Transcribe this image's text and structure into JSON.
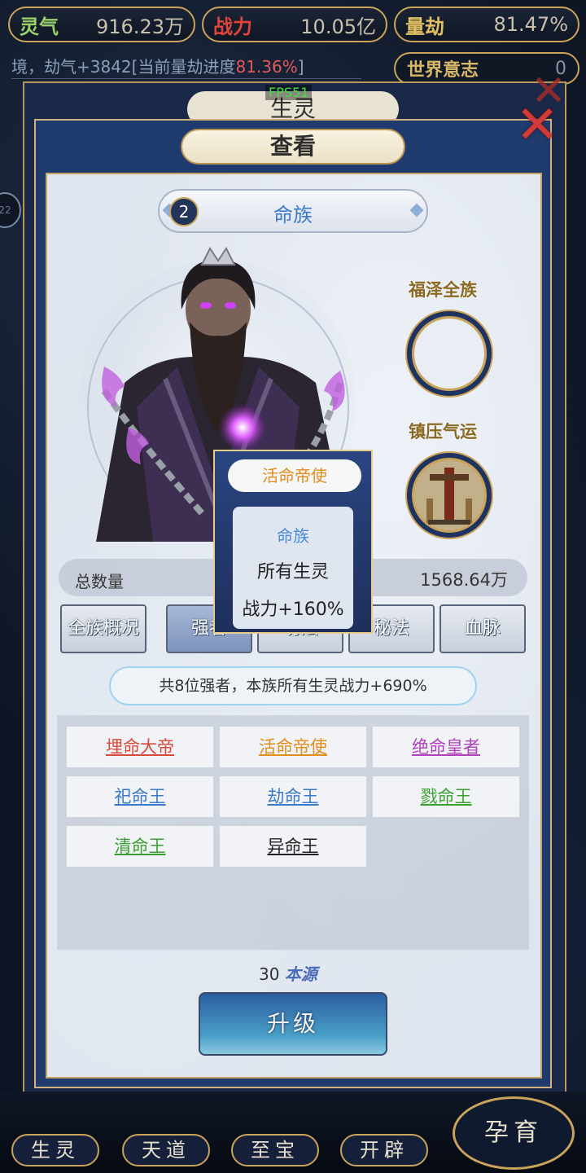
{
  "top_bar": {
    "lingqi_label": "灵气",
    "lingqi_value": "916.23万",
    "zhanli_label": "战力",
    "zhanli_value": "10.05亿",
    "liangjie_label": "量劫",
    "liangjie_value": "81.47%"
  },
  "ticker": {
    "text_prefix": "境，劫气+3842[当前量劫进度",
    "highlight": "81.36%",
    "text_suffix": "]"
  },
  "world_will": {
    "label": "世界意志",
    "value": "0"
  },
  "fps": "FPS51",
  "back_panel_title": "生灵",
  "side_badge": "22",
  "panel": {
    "title": "查看",
    "clan": {
      "level": "2",
      "name": "命族"
    },
    "slots": {
      "slot1_label": "福泽全族",
      "slot2_label": "镇压气运"
    },
    "stats": {
      "label": "总数量",
      "value": "1568.64万"
    },
    "tabs": [
      "全族概况",
      "强者",
      "功法",
      "秘法",
      "血脉"
    ],
    "summary": "共8位强者，本族所有生灵战力+690%",
    "strongmen": [
      {
        "name": "埋命大帝",
        "color": "#d84a3a"
      },
      {
        "name": "活命帝使",
        "color": "#e28c1c"
      },
      {
        "name": "绝命皇者",
        "color": "#b040c0"
      },
      {
        "name": "祀命王",
        "color": "#3a7ac8"
      },
      {
        "name": "劫命王",
        "color": "#3a7ac8"
      },
      {
        "name": "戮命王",
        "color": "#3aa030"
      },
      {
        "name": "清命王",
        "color": "#3aa030"
      },
      {
        "name": "异命王",
        "color": "#222222"
      }
    ],
    "cost_value": "30",
    "cost_unit": "本源",
    "upgrade_label": "升级"
  },
  "tooltip": {
    "title": "活命帝使",
    "clan": "命族",
    "line1": "所有生灵",
    "line2": "战力+160%"
  },
  "bottom_nav": [
    "生灵",
    "天道",
    "至宝",
    "开辟",
    "孕育"
  ],
  "colors": {
    "accent_gold": "#c9a45a",
    "panel_blue": "#1f3a6c"
  }
}
